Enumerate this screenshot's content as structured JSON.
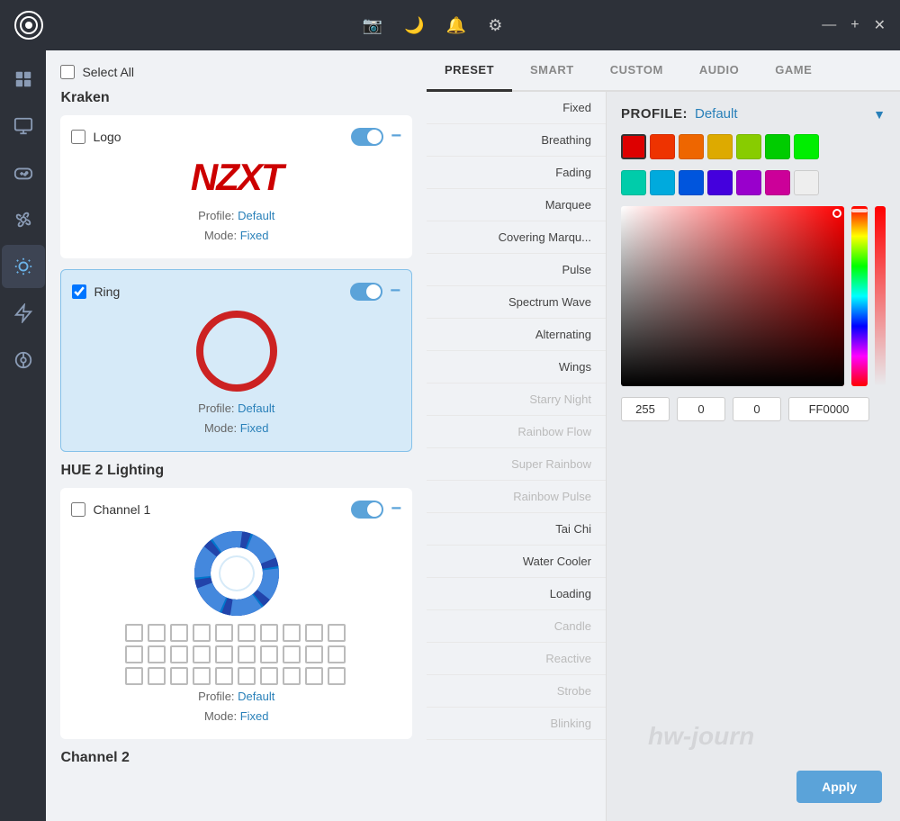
{
  "titlebar": {
    "logo": "○",
    "icons": [
      "camera",
      "moon",
      "bell",
      "gear"
    ],
    "controls": [
      "minimize",
      "maximize",
      "close"
    ],
    "minimize_label": "—",
    "maximize_label": "+",
    "close_label": "✕"
  },
  "sidebar": {
    "items": [
      {
        "name": "dashboard",
        "icon": "⊞",
        "active": false
      },
      {
        "name": "monitor",
        "icon": "🖥",
        "active": false
      },
      {
        "name": "gamepad",
        "icon": "🎮",
        "active": false
      },
      {
        "name": "fan",
        "icon": "⊛",
        "active": false
      },
      {
        "name": "lighting",
        "icon": "✦",
        "active": true
      },
      {
        "name": "power",
        "icon": "⚡",
        "active": false
      },
      {
        "name": "storage",
        "icon": "⊙",
        "active": false
      }
    ]
  },
  "left_panel": {
    "select_all_label": "Select All",
    "sections": [
      {
        "title": "Kraken",
        "devices": [
          {
            "name": "Logo",
            "checked": false,
            "toggle": true,
            "profile": "Default",
            "mode": "Fixed",
            "preview_type": "nzxt_logo"
          },
          {
            "name": "Ring",
            "checked": true,
            "toggle": true,
            "profile": "Default",
            "mode": "Fixed",
            "preview_type": "ring",
            "selected": true
          }
        ]
      },
      {
        "title": "HUE 2 Lighting",
        "devices": [
          {
            "name": "Channel 1",
            "checked": false,
            "toggle": true,
            "profile": "Default",
            "mode": "Fixed",
            "preview_type": "hue_channel"
          },
          {
            "name": "Channel 2",
            "checked": false,
            "toggle": false,
            "profile": null,
            "mode": null,
            "preview_type": "channel2"
          }
        ]
      }
    ]
  },
  "right_panel": {
    "tabs": [
      {
        "label": "PRESET",
        "active": true
      },
      {
        "label": "SMART",
        "active": false
      },
      {
        "label": "CUSTOM",
        "active": false
      },
      {
        "label": "AUDIO",
        "active": false
      },
      {
        "label": "GAME",
        "active": false
      }
    ],
    "effects": [
      {
        "label": "Fixed",
        "active": false,
        "disabled": false
      },
      {
        "label": "Breathing",
        "active": false,
        "disabled": false
      },
      {
        "label": "Fading",
        "active": false,
        "disabled": false
      },
      {
        "label": "Marquee",
        "active": false,
        "disabled": false
      },
      {
        "label": "Covering Marqu...",
        "active": false,
        "disabled": false
      },
      {
        "label": "Pulse",
        "active": false,
        "disabled": false
      },
      {
        "label": "Spectrum Wave",
        "active": false,
        "disabled": false
      },
      {
        "label": "Alternating",
        "active": false,
        "disabled": false
      },
      {
        "label": "Wings",
        "active": false,
        "disabled": false
      },
      {
        "label": "Starry Night",
        "active": false,
        "disabled": true
      },
      {
        "label": "Rainbow Flow",
        "active": false,
        "disabled": true
      },
      {
        "label": "Super Rainbow",
        "active": false,
        "disabled": true
      },
      {
        "label": "Rainbow Pulse",
        "active": false,
        "disabled": true
      },
      {
        "label": "Tai Chi",
        "active": false,
        "disabled": false
      },
      {
        "label": "Water Cooler",
        "active": false,
        "disabled": false
      },
      {
        "label": "Loading",
        "active": false,
        "disabled": false
      },
      {
        "label": "Candle",
        "active": false,
        "disabled": true
      },
      {
        "label": "Reactive",
        "active": false,
        "disabled": true
      },
      {
        "label": "Strobe",
        "active": false,
        "disabled": true
      },
      {
        "label": "Blinking",
        "active": false,
        "disabled": true
      }
    ],
    "profile_label": "PROFILE:",
    "profile_value": "Default",
    "swatches": [
      "#dd0000",
      "#ee3300",
      "#ee6600",
      "#ddaa00",
      "#88cc00",
      "#00cc00",
      "#00dd00",
      "#00ccaa",
      "#00aadd",
      "#0055dd",
      "#4400dd",
      "#9900cc",
      "#cc0099",
      "#eeeeee"
    ],
    "color": {
      "r": 255,
      "g": 0,
      "b": 0,
      "hex": "FF0000"
    },
    "apply_label": "Apply"
  }
}
